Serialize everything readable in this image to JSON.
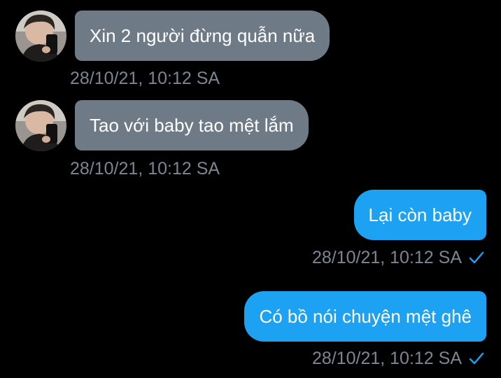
{
  "colors": {
    "background": "#000000",
    "incoming_bubble": "#6f7a87",
    "outgoing_bubble": "#1da1f2",
    "timestamp": "#7b8693",
    "read_check": "#1da1f2"
  },
  "messages": [
    {
      "direction": "incoming",
      "text": "Xin 2 người đừng quẫn nữa",
      "time": "28/10/21, 10:12 SA",
      "avatar_icon": "user-avatar"
    },
    {
      "direction": "incoming",
      "text": "Tao với baby tao mệt lắm",
      "time": "28/10/21, 10:12 SA",
      "avatar_icon": "user-avatar"
    },
    {
      "direction": "outgoing",
      "text": "Lại còn baby",
      "time": "28/10/21, 10:12 SA",
      "status_icon": "check-icon"
    },
    {
      "direction": "outgoing",
      "text": "Có bồ nói chuyện mệt ghê",
      "time": "28/10/21, 10:12 SA",
      "status_icon": "check-icon"
    }
  ]
}
